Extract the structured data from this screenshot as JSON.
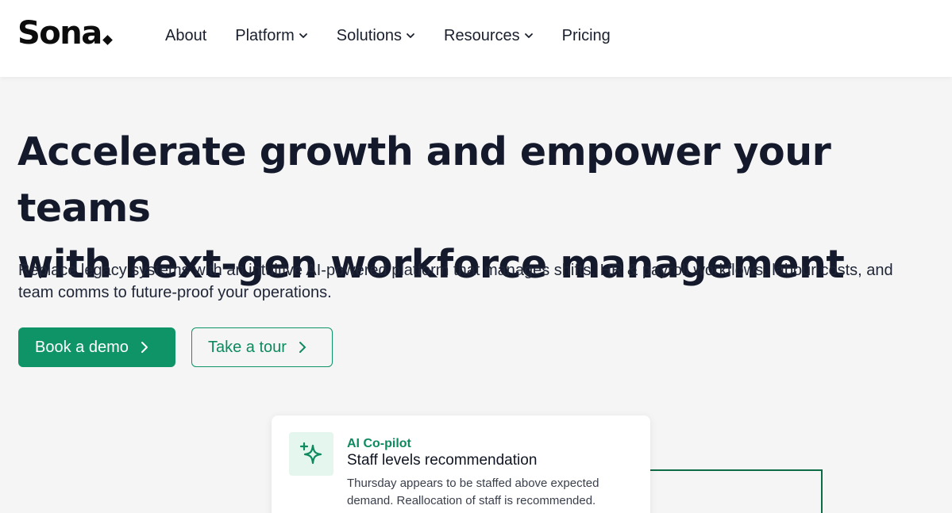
{
  "brand": {
    "logo": "Sona"
  },
  "nav": {
    "items": [
      {
        "label": "About",
        "has_dropdown": false
      },
      {
        "label": "Platform",
        "has_dropdown": true
      },
      {
        "label": "Solutions",
        "has_dropdown": true
      },
      {
        "label": "Resources",
        "has_dropdown": true
      },
      {
        "label": "Pricing",
        "has_dropdown": false
      }
    ],
    "dropdown_icon": "chevron-down-icon"
  },
  "hero": {
    "title_line1": "Accelerate growth and empower your teams",
    "title_line2": "with next-gen workforce management",
    "subtitle": "Replace legacy systems with an intuitive AI-powered platform that manages shifts, HR & payroll workflows, labour costs, and team comms to future-proof your operations.",
    "primary_cta": "Book a demo",
    "secondary_cta": "Take a tour",
    "cta_icon": "chevron-right-icon"
  },
  "card": {
    "icon": "sparkle-icon",
    "kicker": "AI Co-pilot",
    "title": "Staff levels recommendation",
    "body": "Thursday appears to be staffed above expected demand. Reallocation of staff is recommended."
  },
  "colors": {
    "accent": "#0e9466",
    "accent_text": "#0e8a5f",
    "page_bg": "#f4f5f4",
    "heading": "#14192b",
    "frame": "#0d6b45"
  }
}
